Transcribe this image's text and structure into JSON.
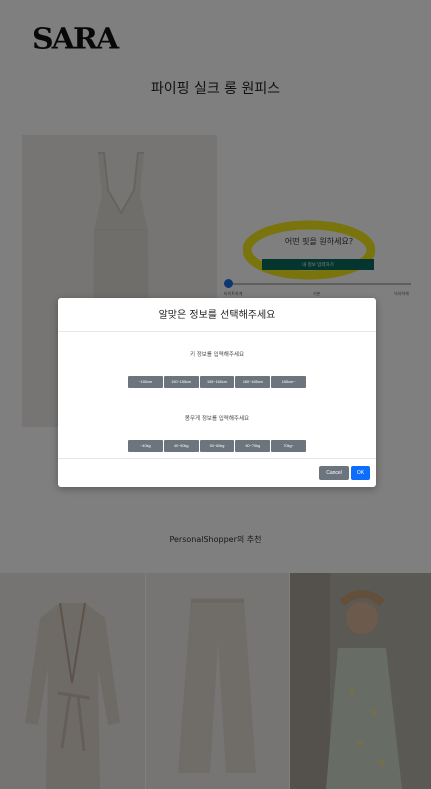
{
  "header": {
    "logo": "SARA"
  },
  "product": {
    "title": "파이핑 실크 롱 원피스"
  },
  "fit": {
    "question": "어떤 핏을 원하세요?",
    "button_label": "내 정보 입력하기",
    "slider_value": 0,
    "slider_labels": [
      "타이트하게",
      "기본",
      "넉넉하게"
    ]
  },
  "recommendations": {
    "title": "PersonalShopper의 추천"
  },
  "modal": {
    "title": "알맞은 정보를 선택해주세요",
    "height_label": "키 정보를 입력해주세요",
    "height_options": [
      "~150cm",
      "150~155cm",
      "155~160cm",
      "160~165cm",
      "165cm~"
    ],
    "weight_label": "몸무게 정보를 입력해주세요",
    "weight_options": [
      "~40kg",
      "40~50kg",
      "50~60kg",
      "60~70kg",
      "70kg~"
    ],
    "cancel_label": "Cancel",
    "ok_label": "OK"
  },
  "colors": {
    "fit_button": "#0b6b5e",
    "option_button": "#6c757d",
    "ok_button": "#0d6efd",
    "highlight": "#f2e600"
  }
}
